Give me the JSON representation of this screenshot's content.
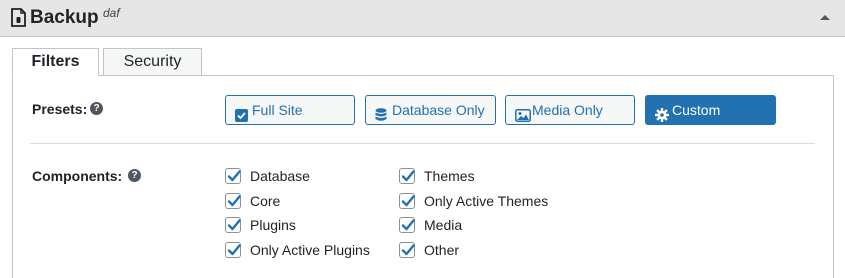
{
  "header": {
    "title": "Backup",
    "subtitle": "daf",
    "icon": "file-icon",
    "toggle_icon": "caret-up-icon"
  },
  "tabs": [
    {
      "label": "Filters",
      "active": true
    },
    {
      "label": "Security",
      "active": false
    }
  ],
  "presets": {
    "label": "Presets:",
    "help": "?",
    "buttons": [
      {
        "label": "Full Site",
        "icon": "checkbox-icon",
        "active": false
      },
      {
        "label": "Database Only",
        "icon": "database-icon",
        "active": false
      },
      {
        "label": "Media Only",
        "icon": "image-icon",
        "active": false
      },
      {
        "label": "Custom",
        "icon": "gear-icon",
        "active": true
      }
    ]
  },
  "components": {
    "label": "Components:",
    "help": "?",
    "items": [
      {
        "label": "Database",
        "checked": true
      },
      {
        "label": "Core",
        "checked": true
      },
      {
        "label": "Plugins",
        "checked": true
      },
      {
        "label": "Only Active Plugins",
        "checked": true
      },
      {
        "label": "Themes",
        "checked": true
      },
      {
        "label": "Only Active Themes",
        "checked": true
      },
      {
        "label": "Media",
        "checked": true
      },
      {
        "label": "Other",
        "checked": true
      }
    ]
  },
  "colors": {
    "accent": "#2271b1",
    "header_bg": "#e6e6e6"
  }
}
